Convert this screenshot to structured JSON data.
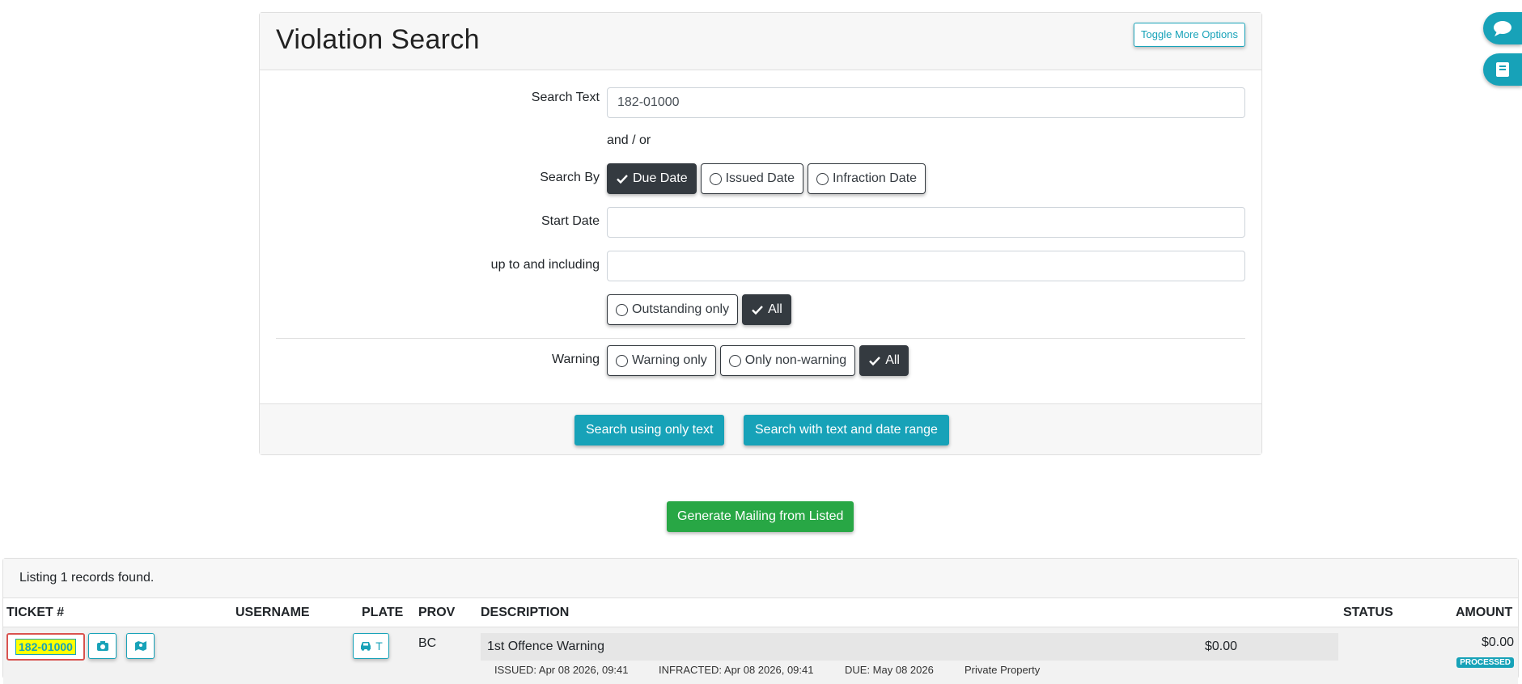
{
  "search_card": {
    "title": "Violation Search",
    "toggle_label": "Toggle More Options",
    "search_text_label": "Search Text",
    "search_text_value": "182-01000",
    "and_or": "and / or",
    "search_by_label": "Search By",
    "search_by_options": [
      "Due Date",
      "Issued Date",
      "Infraction Date"
    ],
    "start_date_label": "Start Date",
    "start_date_value": "",
    "end_date_label": "up to and including",
    "end_date_value": "",
    "outstanding_options": [
      "Outstanding only",
      "All"
    ],
    "warning_label": "Warning",
    "warning_options": [
      "Warning only",
      "Only non-warning",
      "All"
    ],
    "search_text_button": "Search using only text",
    "search_range_button": "Search with text and date range"
  },
  "mailing_button": "Generate Mailing from Listed",
  "results": {
    "summary": "Listing 1 records found.",
    "columns": {
      "ticket": "TICKET #",
      "username": "USERNAME",
      "plate": "PLATE",
      "prov": "PROV",
      "description": "DESCRIPTION",
      "status": "STATUS",
      "amount": "AMOUNT"
    },
    "row": {
      "ticket": "182-01000",
      "plate_btn": "T",
      "prov": "BC",
      "description": "1st Offence Warning",
      "desc_amount": "$0.00",
      "issued": "ISSUED: Apr 08 2026, 09:41",
      "infracted": "INFRACTED: Apr 08 2026, 09:41",
      "due": "DUE: May 08 2026",
      "property": "Private Property",
      "amount": "$0.00",
      "status_badge": "PROCESSED"
    }
  },
  "colors": {
    "accent": "#17a2b8",
    "dark": "#343a40",
    "success": "#28a745",
    "highlight": "#ffff00",
    "outline": "#d9534f"
  }
}
